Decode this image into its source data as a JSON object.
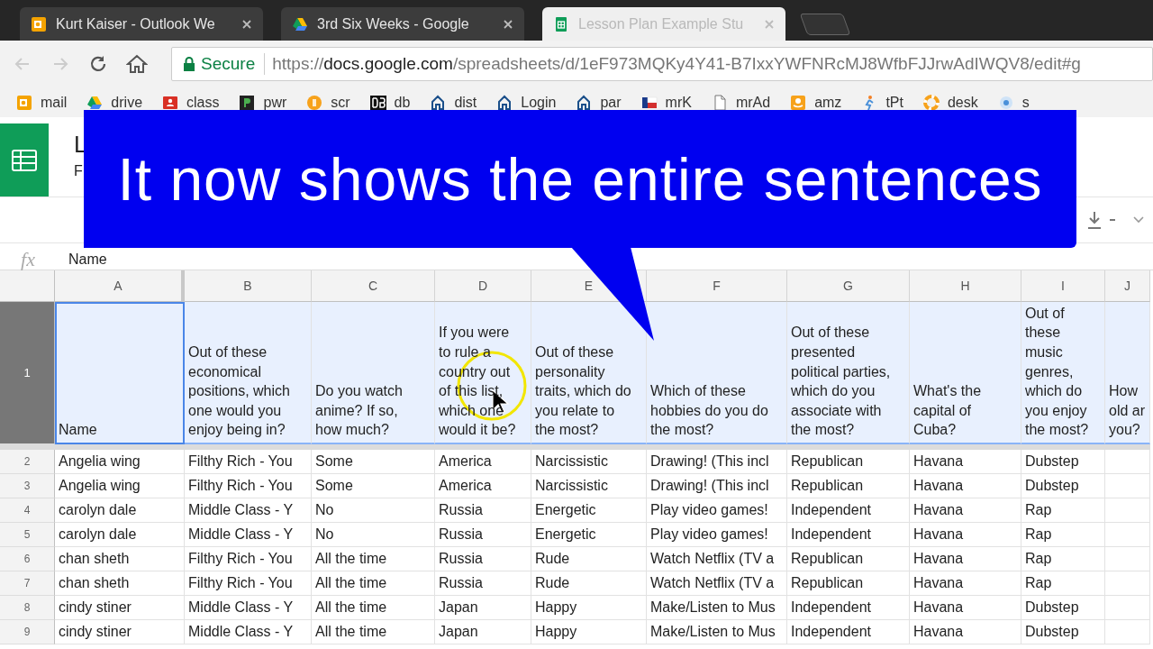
{
  "tabs": [
    {
      "title": "Kurt Kaiser - Outlook We",
      "kind": "outlook",
      "selected": false
    },
    {
      "title": "3rd Six Weeks - Google",
      "kind": "drive",
      "selected": false
    },
    {
      "title": "Lesson Plan Example Stu",
      "kind": "sheets",
      "selected": true
    }
  ],
  "address_bar": {
    "secure_label": "Secure",
    "url": {
      "scheme": "https://",
      "host": "docs.google.com",
      "path": "/spreadsheets/d/1eF973MQKy4Y41-B7IxxYWFNRcMJ8WfbFJJrwAdIWQV8/edit#g"
    }
  },
  "bookmarks": [
    {
      "label": "mail",
      "kind": "outlook"
    },
    {
      "label": "drive",
      "kind": "drive"
    },
    {
      "label": "class",
      "kind": "classroom"
    },
    {
      "label": "pwr",
      "kind": "dark"
    },
    {
      "label": "scr",
      "kind": "orange-circle"
    },
    {
      "label": "db",
      "kind": "black"
    },
    {
      "label": "dist",
      "kind": "house"
    },
    {
      "label": "Login",
      "kind": "house"
    },
    {
      "label": "par",
      "kind": "house"
    },
    {
      "label": "mrK",
      "kind": "flag"
    },
    {
      "label": "mrAd",
      "kind": "page"
    },
    {
      "label": "amz",
      "kind": "amazon"
    },
    {
      "label": "tPt",
      "kind": "runner"
    },
    {
      "label": "desk",
      "kind": "ring"
    },
    {
      "label": "s",
      "kind": "circle"
    }
  ],
  "document": {
    "title": "L",
    "menu": "F"
  },
  "formula_bar": {
    "fx": "fx",
    "value": "Name"
  },
  "columns": [
    "A",
    "B",
    "C",
    "D",
    "E",
    "F",
    "G",
    "H",
    "I",
    "J"
  ],
  "rows": [
    {
      "number": "1",
      "selected": true,
      "cells": [
        {
          "text": "Name",
          "selected": true
        },
        {
          "text": "Out of these economical positions, which one would you enjoy being in?",
          "selected": false
        },
        {
          "text": "Do you watch anime? If so, how much?",
          "selected": false
        },
        {
          "text": "If you were to rule a country out of this list, which one would it be?",
          "selected": false
        },
        {
          "text": "Out of these personality traits, which do you relate to the most?",
          "selected": false
        },
        {
          "text": "Which of these hobbies do you do the most?",
          "selected": false
        },
        {
          "text": "Out of these presented political parties, which do you associate with the most?",
          "selected": false
        },
        {
          "text": "What's the capital of Cuba?",
          "selected": false
        },
        {
          "text": "Out of these music genres, which do you enjoy the most?",
          "selected": false
        },
        {
          "text": "How\nold ar\nyou?",
          "selected": false
        }
      ]
    },
    {
      "number": "2",
      "selected": false,
      "cells": [
        "Angelia wing",
        "Filthy Rich - You",
        "Some",
        "America",
        "Narcissistic",
        "Drawing! (This incl",
        "Republican",
        "Havana",
        "Dubstep"
      ]
    },
    {
      "number": "3",
      "selected": false,
      "cells": [
        "Angelia wing",
        "Filthy Rich - You",
        "Some",
        "America",
        "Narcissistic",
        "Drawing! (This incl",
        "Republican",
        "Havana",
        "Dubstep"
      ]
    },
    {
      "number": "4",
      "selected": false,
      "cells": [
        "carolyn dale",
        "Middle Class - Y",
        "No",
        "Russia",
        "Energetic",
        "Play video games!",
        "Independent",
        "Havana",
        "Rap"
      ]
    },
    {
      "number": "5",
      "selected": false,
      "cells": [
        "carolyn dale",
        "Middle Class - Y",
        "No",
        "Russia",
        "Energetic",
        "Play video games!",
        "Independent",
        "Havana",
        "Rap"
      ]
    },
    {
      "number": "6",
      "selected": false,
      "cells": [
        "chan sheth",
        "Filthy Rich - You",
        "All the time",
        "Russia",
        "Rude",
        "Watch Netflix (TV a",
        "Republican",
        "Havana",
        "Rap"
      ]
    },
    {
      "number": "7",
      "selected": false,
      "cells": [
        "chan sheth",
        "Filthy Rich - You",
        "All the time",
        "Russia",
        "Rude",
        "Watch Netflix (TV a",
        "Republican",
        "Havana",
        "Rap"
      ]
    },
    {
      "number": "8",
      "selected": false,
      "cells": [
        "cindy stiner",
        "Middle Class - Y",
        "All the time",
        "Japan",
        "Happy",
        "Make/Listen to Mus",
        "Independent",
        "Havana",
        "Dubstep"
      ]
    },
    {
      "number": "9",
      "selected": false,
      "cells": [
        "cindy stiner",
        "Middle Class - Y",
        "All the time",
        "Japan",
        "Happy",
        "Make/Listen to Mus",
        "Independent",
        "Havana",
        "Dubstep"
      ]
    }
  ],
  "callout": {
    "text": "It now shows the entire sentences"
  }
}
